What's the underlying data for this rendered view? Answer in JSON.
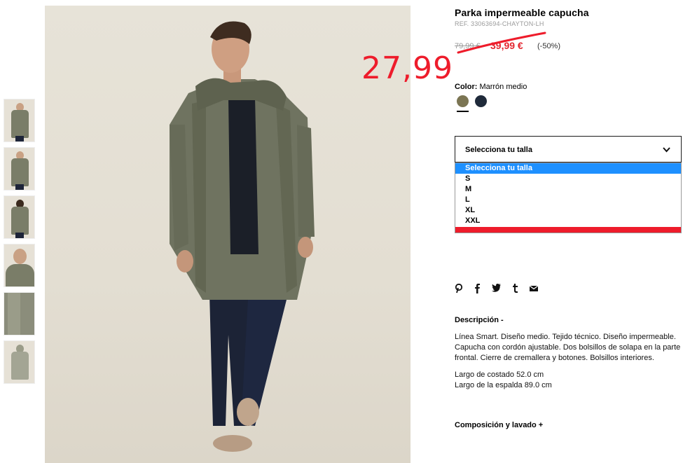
{
  "product": {
    "title": "Parka impermeable capucha",
    "ref": "REF. 33063694-CHAYTON-LH",
    "old_price": "79,99 €",
    "sale_price": "39,99 €",
    "discount": "(-50%)",
    "annotation_price": "27,99"
  },
  "color": {
    "label": "Color:",
    "value": "Marrón medio",
    "swatches": [
      {
        "name": "Marrón medio",
        "hex": "#7b7553"
      },
      {
        "name": "navy",
        "hex": "#1f2a3a"
      }
    ]
  },
  "size": {
    "selected_label": "Selecciona tu talla",
    "options": [
      "Selecciona tu talla",
      "S",
      "M",
      "L",
      "XL",
      "XXL"
    ]
  },
  "share_icons": [
    "pinterest-icon",
    "facebook-icon",
    "twitter-icon",
    "tumblr-icon",
    "email-icon"
  ],
  "description": {
    "heading": "Descripción -",
    "text": "Línea Smart. Diseño medio. Tejido técnico. Diseño impermeable. Capucha con cordón ajustable. Dos bolsillos de solapa en la parte frontal. Cierre de cremallera y botones. Bolsillos interiores.",
    "measure_1": "Largo de costado 52.0 cm",
    "measure_2": "Largo de la espalda 89.0 cm"
  },
  "composition_heading": "Composición y lavado +",
  "colors": {
    "accent_red": "#ee1c2b",
    "sale_red": "#e3262f",
    "selection_blue": "#1e90ff"
  }
}
